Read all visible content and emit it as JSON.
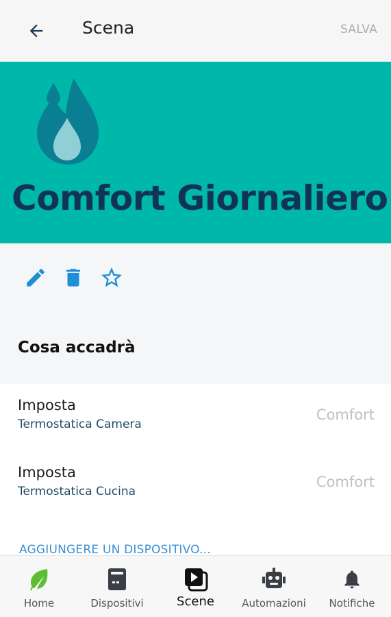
{
  "header": {
    "title": "Scena",
    "save_label": "SALVA",
    "back_icon": "arrow-left-icon"
  },
  "hero": {
    "title": "Comfort Giornaliero",
    "icon": "water-drops-icon",
    "background": "#00b8aa",
    "title_color": "#123454"
  },
  "actions": [
    {
      "icon": "pencil-icon"
    },
    {
      "icon": "trash-icon"
    },
    {
      "icon": "star-outline-icon"
    }
  ],
  "section": {
    "title": "Cosa accadrà"
  },
  "items": [
    {
      "title": "Imposta",
      "device": "Termostatica Camera",
      "value": "Comfort"
    },
    {
      "title": "Imposta",
      "device": "Termostatica Cucina",
      "value": "Comfort"
    }
  ],
  "add_device_label": "AGGIUNGERE UN DISPOSITIVO...",
  "bottom_nav": [
    {
      "label": "Home",
      "icon": "leaf-icon",
      "active": false
    },
    {
      "label": "Dispositivi",
      "icon": "device-icon",
      "active": false
    },
    {
      "label": "Scene",
      "icon": "scene-play-icon",
      "active": true
    },
    {
      "label": "Automazioni",
      "icon": "robot-icon",
      "active": false
    },
    {
      "label": "Notifiche",
      "icon": "bell-icon",
      "active": false
    }
  ],
  "colors": {
    "accent": "#1e8fd6",
    "link": "#3a8fd6"
  }
}
